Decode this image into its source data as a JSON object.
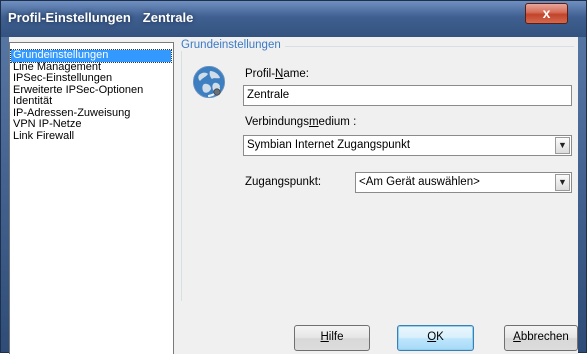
{
  "window": {
    "title_app": "Profil-Einstellungen",
    "title_profile": "Zentrale",
    "close_glyph": "x"
  },
  "nav": {
    "items": [
      {
        "label": "Grundeinstellungen",
        "selected": true
      },
      {
        "label": "Line Management"
      },
      {
        "label": "IPSec-Einstellungen"
      },
      {
        "label": "Erweiterte IPSec-Optionen"
      },
      {
        "label": "Identität"
      },
      {
        "label": "IP-Adressen-Zuweisung"
      },
      {
        "label": "VPN IP-Netze"
      },
      {
        "label": "Link Firewall"
      }
    ]
  },
  "main": {
    "group_title": "Grundeinstellungen",
    "icon": "globe-network-icon",
    "profile_name": {
      "label_pre": "Profil-",
      "label_accel": "N",
      "label_post": "ame:",
      "value": "Zentrale"
    },
    "connection_medium": {
      "label_pre": "Verbindungs",
      "label_accel": "m",
      "label_post": "edium :",
      "value": "Symbian Internet Zugangspunkt"
    },
    "access_point": {
      "label": "Zugangspunkt:",
      "value": "<Am Gerät auswählen>"
    }
  },
  "buttons": {
    "help": {
      "accel": "H",
      "rest": "ilfe"
    },
    "ok": {
      "accel": "O",
      "rest": "K"
    },
    "cancel": {
      "accel": "A",
      "rest": "bbrechen"
    }
  }
}
